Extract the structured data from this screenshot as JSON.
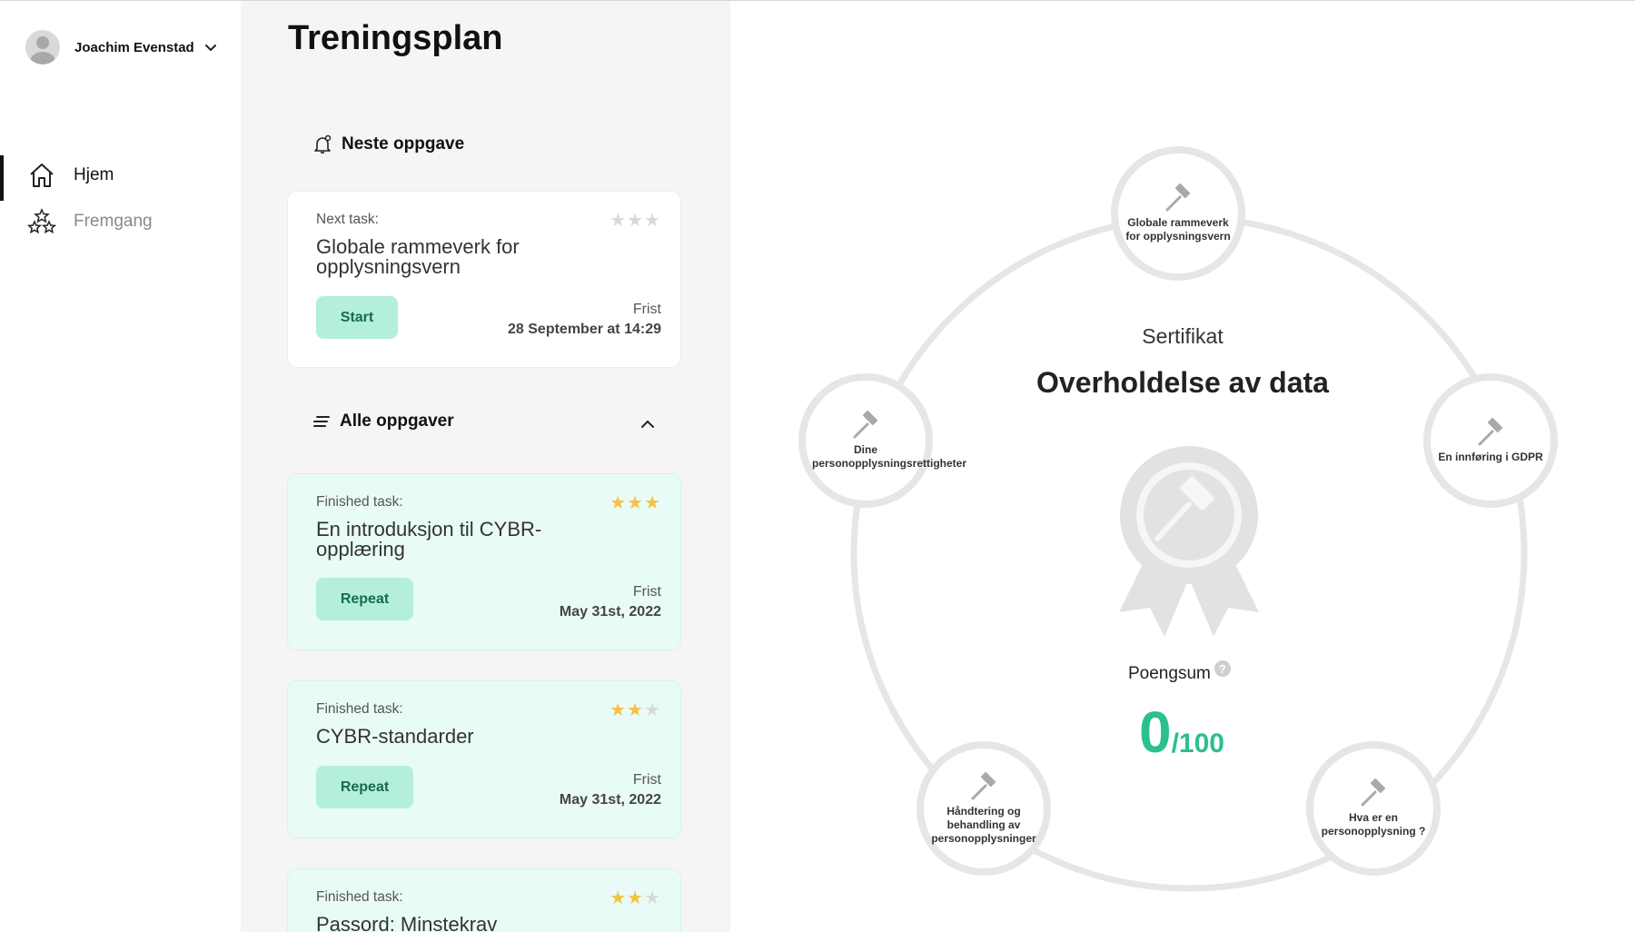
{
  "user": {
    "name": "Joachim Evenstad"
  },
  "nav": {
    "items": [
      {
        "label": "Hjem",
        "active": true,
        "icon": "home-icon"
      },
      {
        "label": "Fremgang",
        "active": false,
        "icon": "stars-icon"
      }
    ]
  },
  "page": {
    "title": "Treningsplan"
  },
  "next_section": {
    "label": "Neste oppgave",
    "icon": "bell-icon"
  },
  "next_task": {
    "kind": "Next task:",
    "title": "Globale rammeverk for opplysningsvern",
    "stars": 0,
    "button": "Start",
    "deadline_label": "Frist",
    "deadline_value": "28 September at 14:29"
  },
  "all_section": {
    "label": "Alle oppgaver",
    "icon": "list-icon"
  },
  "tasks": [
    {
      "kind": "Finished task:",
      "title": "En introduksjon til CYBR-opplæring",
      "stars": 3,
      "button": "Repeat",
      "deadline_label": "Frist",
      "deadline_value": "May 31st, 2022"
    },
    {
      "kind": "Finished task:",
      "title": "CYBR-standarder",
      "stars": 2,
      "button": "Repeat",
      "deadline_label": "Frist",
      "deadline_value": "May 31st, 2022"
    },
    {
      "kind": "Finished task:",
      "title": "Passord: Minstekrav",
      "stars": 2
    }
  ],
  "certificate": {
    "label": "Sertifikat",
    "name": "Overholdelse av data",
    "score_label": "Poengsum",
    "help": "?",
    "score": "0",
    "score_max": "/100",
    "modules": [
      "Globale rammeverk for opplysningsvern",
      "En innføring i GDPR",
      "Hva er en personopplysning ?",
      "Håndtering og behandling av personopplysninger",
      "Dine personopplysningsrettigheter"
    ]
  },
  "colors": {
    "accent": "#2cbf90",
    "button_bg": "#b4efdc",
    "finished_card_bg": "#e9fbf6",
    "star": "#f5c242"
  }
}
